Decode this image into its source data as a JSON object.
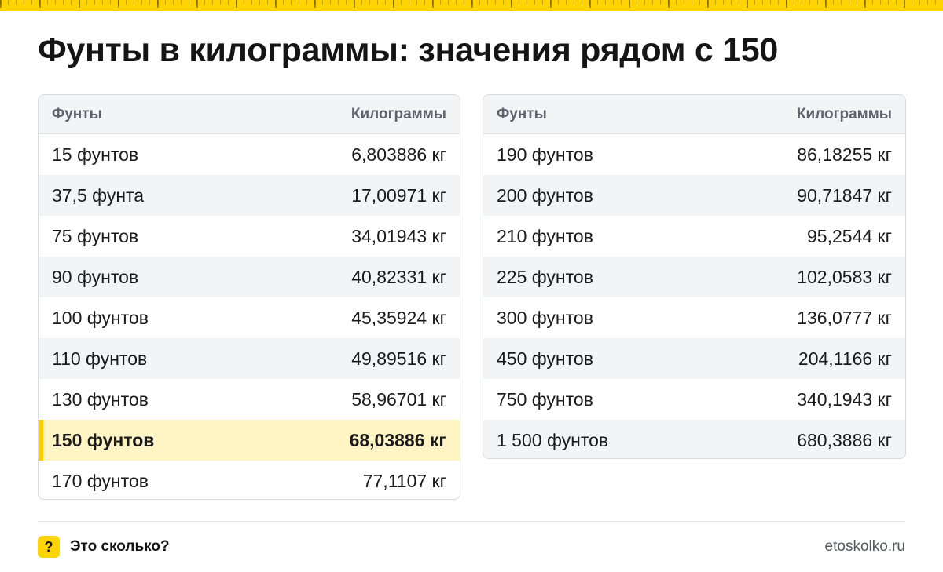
{
  "title": "Фунты в килограммы: значения рядом с 150",
  "tables": {
    "left": {
      "headers": [
        "Фунты",
        "Килограммы"
      ],
      "rows": [
        {
          "pounds": "15 фунтов",
          "kg": "6,803886 кг"
        },
        {
          "pounds": "37,5 фунта",
          "kg": "17,00971 кг"
        },
        {
          "pounds": "75 фунтов",
          "kg": "34,01943 кг"
        },
        {
          "pounds": "90 фунтов",
          "kg": "40,82331 кг"
        },
        {
          "pounds": "100 фунтов",
          "kg": "45,35924 кг"
        },
        {
          "pounds": "110 фунтов",
          "kg": "49,89516 кг"
        },
        {
          "pounds": "130 фунтов",
          "kg": "58,96701 кг"
        },
        {
          "pounds": "150 фунтов",
          "kg": "68,03886 кг",
          "highlighted": true
        },
        {
          "pounds": "170 фунтов",
          "kg": "77,1107 кг"
        }
      ]
    },
    "right": {
      "headers": [
        "Фунты",
        "Килограммы"
      ],
      "rows": [
        {
          "pounds": "190 фунтов",
          "kg": "86,18255 кг"
        },
        {
          "pounds": "200 фунтов",
          "kg": "90,71847 кг"
        },
        {
          "pounds": "210 фунтов",
          "kg": "95,2544 кг"
        },
        {
          "pounds": "225 фунтов",
          "kg": "102,0583 кг"
        },
        {
          "pounds": "300 фунтов",
          "kg": "136,0777 кг"
        },
        {
          "pounds": "450 фунтов",
          "kg": "204,1166 кг"
        },
        {
          "pounds": "750 фунтов",
          "kg": "340,1943 кг"
        },
        {
          "pounds": "1 500 фунтов",
          "kg": "680,3886 кг"
        }
      ]
    }
  },
  "footer": {
    "icon": "question-mark-icon",
    "icon_glyph": "?",
    "brand": "Это сколько?",
    "site": "etoskolko.ru"
  },
  "colors": {
    "accent": "#ffd400",
    "highlight_row": "#fff4c4",
    "highlight_bar": "#ffcc00"
  }
}
